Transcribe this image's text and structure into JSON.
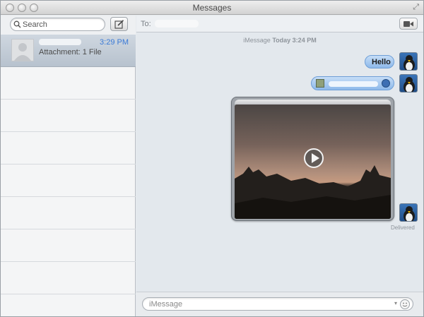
{
  "window": {
    "title": "Messages"
  },
  "sidebar": {
    "search": {
      "placeholder": "Search"
    },
    "conversations": [
      {
        "time": "3:29 PM",
        "preview": "Attachment: 1 File",
        "selected": true
      },
      {},
      {},
      {},
      {},
      {},
      {},
      {}
    ]
  },
  "main": {
    "to_label": "To:",
    "timestamp": {
      "service": "iMessage",
      "when": "Today 3:24 PM"
    },
    "messages": [
      {
        "type": "text",
        "text": "Hello"
      },
      {
        "type": "file-attachment"
      },
      {
        "type": "video"
      }
    ],
    "delivery_status": "Delivered",
    "composer": {
      "placeholder": "iMessage"
    }
  },
  "colors": {
    "accent": "#3a7ad6",
    "bubble": "#a9ccf2",
    "selected_row": "#c3ccd7"
  },
  "icons": [
    "search-icon",
    "compose-icon",
    "video-call-icon",
    "play-icon",
    "emoji-icon"
  ]
}
